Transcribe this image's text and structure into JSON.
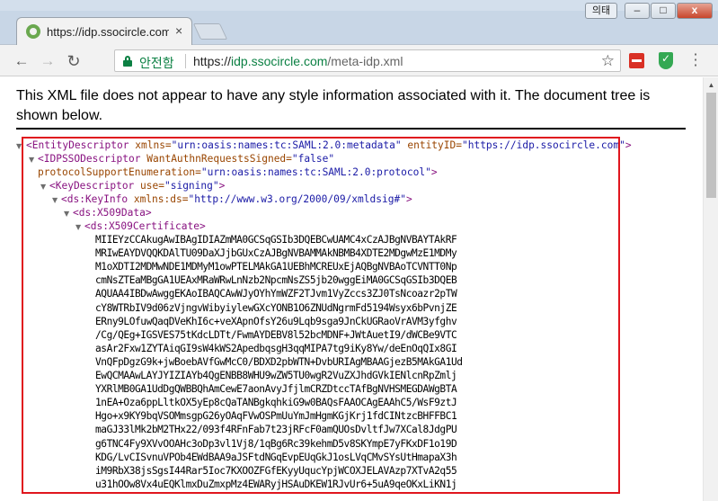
{
  "tab": {
    "title": "https://idp.ssocircle.com",
    "close": "×"
  },
  "window": {
    "user_label": "의태",
    "minimize": "–",
    "maximize": "□",
    "close": "x"
  },
  "toolbar": {
    "secure_label": "안전함",
    "url_scheme": "https://",
    "url_host": "idp.ssocircle.com",
    "url_path": "/meta-idp.xml"
  },
  "notice": {
    "text": "This XML file does not appear to have any style information associated with it. The document tree is shown below."
  },
  "xml": {
    "entity_open_tag": "<EntityDescriptor",
    "entity_xmlns_name": " xmlns=",
    "entity_xmlns_value": "\"urn:oasis:names:tc:SAML:2.0:metadata\"",
    "entity_id_name": " entityID=",
    "entity_id_value": "\"https://idp.ssocircle.com\"",
    "entity_close": ">",
    "idp_open_tag": "<IDPSSODescriptor",
    "idp_want_name": " WantAuthnRequestsSigned=",
    "idp_want_value": "\"false\"",
    "idp_protocol_name": "protocolSupportEnumeration=",
    "idp_protocol_value": "\"urn:oasis:names:tc:SAML:2.0:protocol\"",
    "idp_close": ">",
    "keydesc_open_tag": "<KeyDescriptor",
    "keydesc_use_name": " use=",
    "keydesc_use_value": "\"signing\"",
    "keydesc_close": ">",
    "keyinfo_open_tag": "<ds:KeyInfo",
    "keyinfo_xmlns_name": " xmlns:ds=",
    "keyinfo_xmlns_value": "\"http://www.w3.org/2000/09/xmldsig#\"",
    "keyinfo_close": ">",
    "x509data_tag": "<ds:X509Data>",
    "x509cert_tag": "<ds:X509Certificate>",
    "certificate_lines": [
      "MIIEYzCCAkugAwIBAgIDIAZmMA0GCSqGSIb3DQEBCwUAMC4xCzAJBgNVBAYTAkRF",
      "MRIwEAYDVQQKDAlTU09DaXJjbGUxCzAJBgNVBAMMAkNBMB4XDTE2MDgwMzE1MDMy",
      "M1oXDTI2MDMwNDE1MDMyM1owPTELMAkGA1UEBhMCREUxEjAQBgNVBAoTCVNTT0Np",
      "cmNsZTEaMBgGA1UEAxMRaWRwLnNzb2NpcmNsZS5jb20wggEiMA0GCSqGSIb3DQEB",
      "AQUAA4IBDwAwggEKAoIBAQCAwWJyOYhYmWZF2TJvm1VyZccs3ZJ0TsNcoazr2pTW",
      "cY8WTRbIV9d06zVjngvWibyiylewGXcYONB1O6ZNUdNgrmFd5194Wsyx6bPvnjZE",
      "ERny9LOfuwQaqDVeKhI6c+veXApnOfsY26u9Lqb9sga9JnCkUGRaoVrAVM3yfghv",
      "/Cg/QEg+IGSVES75tKdcLDTt/FwmAYDEBV8l52bcMDNF+JWtAuetI9/dWCBe9VTC",
      "asAr2Fxw1ZYTAiqGI9sW4kWS2ApedbqsgH3qqMIPA7tg9iKy8Yw/deEnOqQIx8GI",
      "VnQFpDgzG9k+jwBoebAVfGwMcC0/BDXD2pbWTN+DvbURIAgMBAAGjezB5MAkGA1Ud",
      "EwQCMAAwLAYJYIZIAYb4QgENBB8WHU9wZW5TU0wgR2VuZXJhdGVkIENlcnRpZmlj",
      "YXRlMB0GA1UdDgQWBBQhAmCewE7aonAvyJfjlmCRZDtccTAfBgNVHSMEGDAWgBTA",
      "1nEA+Oza6ppLltkOX5yEp8cQaTANBgkqhkiG9w0BAQsFAAOCAgEAAhC5/WsF9ztJ",
      "Hgo+x9KY9bqVSOMmsgpG26yOAqFVwOSPmUuYmJmHgmKGjKrj1fdCINtzcBHFFBC1",
      "maGJ33lMk2bM2THx22/093f4RFnFab7t23jRFcF0amQUOsDvltfJw7XCal8JdgPU",
      "g6TNC4Fy9XVvOOAHc3oDp3vl1Vj8/1qBg6Rc39kehmD5v8SKYmpE7yFKxDF1o19D",
      "KDG/LvCISvnuVPOb4EWdBAA9aJSFtdNGqEvpEUqGkJ1osLVqCMvSYsUtHmapaX3h",
      "iM9RbX38jsSgsI44Rar5Ioc7KXOOZFGfEKyyUqucYpjWCOXJELAVAzp7XTvA2q55",
      "u31hOOw8Vx4uEQKlmxDuZmxpMz4EWARyjHSAuDKEW1RJvUr6+5uA9qeOKxLiKN1j"
    ]
  }
}
